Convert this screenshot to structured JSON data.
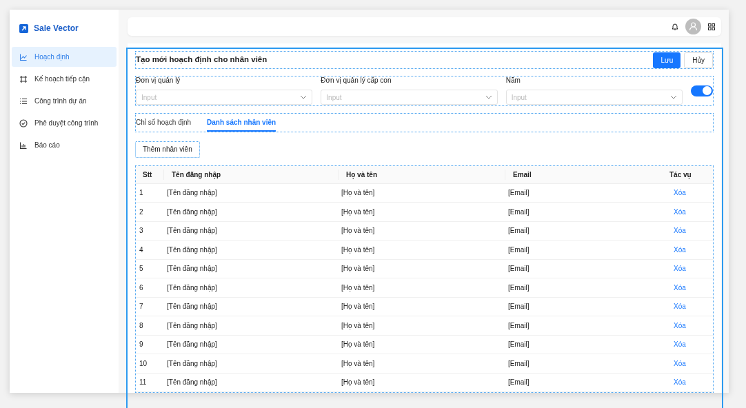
{
  "brand": {
    "name": "Sale Vector"
  },
  "sidebar": {
    "items": [
      {
        "label": "Hoạch định",
        "kind": "chart",
        "selected": true
      },
      {
        "label": "Kế hoạch tiếp cận",
        "kind": "frame",
        "selected": false
      },
      {
        "label": "Công trình dự án",
        "kind": "list",
        "selected": false
      },
      {
        "label": "Phê duyệt công trình",
        "kind": "check",
        "selected": false
      },
      {
        "label": "Báo cáo",
        "kind": "bars",
        "selected": false
      }
    ]
  },
  "form": {
    "title": "Tạo mới hoạch định cho nhân viên",
    "buttons": [
      {
        "label": "Lưu",
        "kind": "primary"
      },
      {
        "label": "Hủy",
        "kind": "default"
      }
    ],
    "fields": [
      {
        "label": "Đơn vị quản lý",
        "placeholder": "Input"
      },
      {
        "label": "Đơn vị quản lý cấp con",
        "placeholder": "Input"
      },
      {
        "label": "Năm",
        "placeholder": "Input"
      }
    ],
    "toggle": {
      "on": true
    }
  },
  "tabs": [
    {
      "label": "Chỉ số hoạch định",
      "selected": false
    },
    {
      "label": "Danh sách nhân viên",
      "selected": true
    }
  ],
  "add_button": "Thêm nhân viên",
  "table": {
    "columns": [
      "Stt",
      "Tên đăng nhập",
      "Họ và tên",
      "Email",
      "Tác vụ"
    ],
    "rows": [
      [
        "1",
        "[Tên đăng nhập]",
        "[Họ và tên]",
        "[Email]",
        "Xóa"
      ],
      [
        "2",
        "[Tên đăng nhập]",
        "[Họ và tên]",
        "[Email]",
        "Xóa"
      ],
      [
        "3",
        "[Tên đăng nhập]",
        "[Họ và tên]",
        "[Email]",
        "Xóa"
      ],
      [
        "4",
        "[Tên đăng nhập]",
        "[Họ và tên]",
        "[Email]",
        "Xóa"
      ],
      [
        "5",
        "[Tên đăng nhập]",
        "[Họ và tên]",
        "[Email]",
        "Xóa"
      ],
      [
        "6",
        "[Tên đăng nhập]",
        "[Họ và tên]",
        "[Email]",
        "Xóa"
      ],
      [
        "7",
        "[Tên đăng nhập]",
        "[Họ và tên]",
        "[Email]",
        "Xóa"
      ],
      [
        "8",
        "[Tên đăng nhập]",
        "[Họ và tên]",
        "[Email]",
        "Xóa"
      ],
      [
        "9",
        "[Tên đăng nhập]",
        "[Họ và tên]",
        "[Email]",
        "Xóa"
      ],
      [
        "10",
        "[Tên đăng nhập]",
        "[Họ và tên]",
        "[Email]",
        "Xóa"
      ],
      [
        "11",
        "[Tên đăng nhập]",
        "[Họ và tên]",
        "[Email]",
        "Xóa"
      ]
    ]
  }
}
